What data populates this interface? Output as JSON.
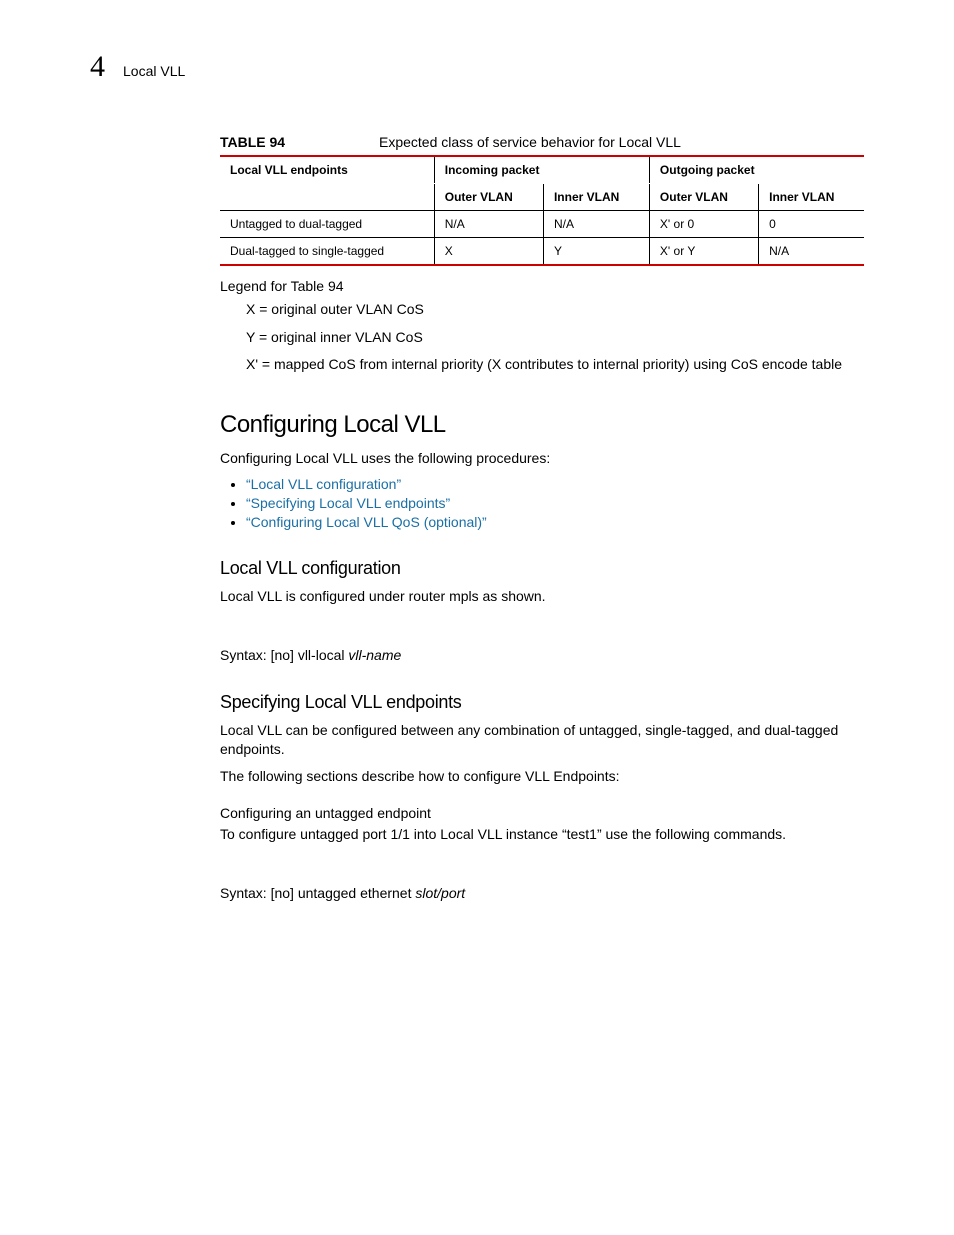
{
  "header": {
    "chapter_number": "4",
    "section_title": "Local VLL"
  },
  "table": {
    "label": "TABLE 94",
    "caption": "Expected class of service behavior for Local VLL",
    "col_group_left": "Local VLL endpoints",
    "col_group_in": "Incoming packet",
    "col_group_out": "Outgoing packet",
    "sub_outer": "Outer VLAN",
    "sub_inner": "Inner VLAN",
    "rows": [
      {
        "ep": "Untagged to dual-tagged",
        "in_outer": "N/A",
        "in_inner": "N/A",
        "out_outer": "X' or 0",
        "out_inner": "0"
      },
      {
        "ep": "Dual-tagged to single-tagged",
        "in_outer": "X",
        "in_inner": "Y",
        "out_outer": "X' or Y",
        "out_inner": "N/A"
      }
    ]
  },
  "legend": {
    "title": "Legend for Table 94",
    "items": [
      "X = original outer VLAN CoS",
      "Y = original inner VLAN CoS",
      "X' = mapped CoS from internal priority (X contributes to internal priority) using CoS encode table"
    ]
  },
  "sec_config": {
    "title": "Configuring Local VLL",
    "intro": "Configuring Local VLL uses the following procedures:",
    "links": [
      "“Local VLL configuration”",
      "“Specifying Local VLL endpoints”",
      "“Configuring Local VLL QoS (optional)”"
    ]
  },
  "sub_localcfg": {
    "title": "Local VLL configuration",
    "body": "Local VLL is configured under router mpls as shown.",
    "syntax_prefix": "Syntax:  [no] vll-local ",
    "syntax_arg": "vll-name"
  },
  "sub_endpoints": {
    "title": "Specifying Local VLL endpoints",
    "p1": "Local VLL can be configured between any combination of untagged, single-tagged, and dual-tagged endpoints.",
    "p2": "The following sections describe how to configure VLL Endpoints:",
    "cfg_title": "Configuring an untagged endpoint",
    "cfg_body": "To configure untagged port 1/1 into Local VLL instance “test1” use the following commands.",
    "syntax_prefix": "Syntax:  [no] untagged ethernet  ",
    "syntax_arg": "slot/port"
  }
}
